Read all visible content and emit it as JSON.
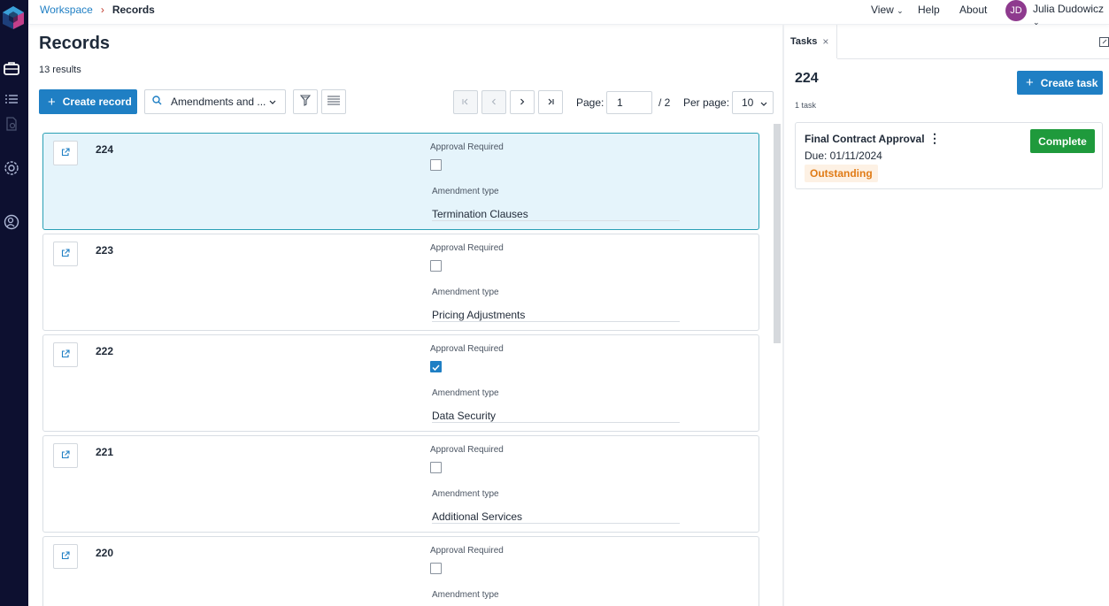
{
  "breadcrumb": {
    "workspace": "Workspace",
    "separator": "›",
    "current": "Records"
  },
  "topnav": {
    "view": "View",
    "help": "Help",
    "about": "About",
    "user_initials": "JD",
    "user_name": "Julia Dudowicz",
    "chevron": "⌄"
  },
  "main": {
    "title": "Records",
    "results": "13 results",
    "create_record": "Create record",
    "view_selector": "Amendments and ...",
    "pager": {
      "page_label": "Page:",
      "page": "1",
      "total": "/ 2",
      "per_page_label": "Per page:",
      "per_page": "10"
    }
  },
  "records": [
    {
      "id": "224",
      "approval_label": "Approval Required",
      "approval": false,
      "amendment_label": "Amendment type",
      "amendment": "Termination Clauses",
      "selected": true
    },
    {
      "id": "223",
      "approval_label": "Approval Required",
      "approval": false,
      "amendment_label": "Amendment type",
      "amendment": "Pricing Adjustments",
      "selected": false
    },
    {
      "id": "222",
      "approval_label": "Approval Required",
      "approval": true,
      "amendment_label": "Amendment type",
      "amendment": "Data Security",
      "selected": false
    },
    {
      "id": "221",
      "approval_label": "Approval Required",
      "approval": false,
      "amendment_label": "Amendment type",
      "amendment": "Additional Services",
      "selected": false
    },
    {
      "id": "220",
      "approval_label": "Approval Required",
      "approval": false,
      "amendment_label": "Amendment type",
      "amendment": "",
      "selected": false
    }
  ],
  "tasks_panel": {
    "tab_label": "Tasks",
    "close": "×",
    "record_id": "224",
    "count": "1 task",
    "create_task": "Create task",
    "task": {
      "name": "Final Contract Approval",
      "due": "Due: 01/11/2024",
      "status": "Outstanding",
      "complete": "Complete"
    }
  },
  "colors": {
    "rail": "#0d1030",
    "accent": "#1f7fc4",
    "selected_bg": "#e5f4fb",
    "selected_border": "#2aa0b5",
    "complete": "#1f9a3c",
    "status_text": "#e07b16"
  }
}
